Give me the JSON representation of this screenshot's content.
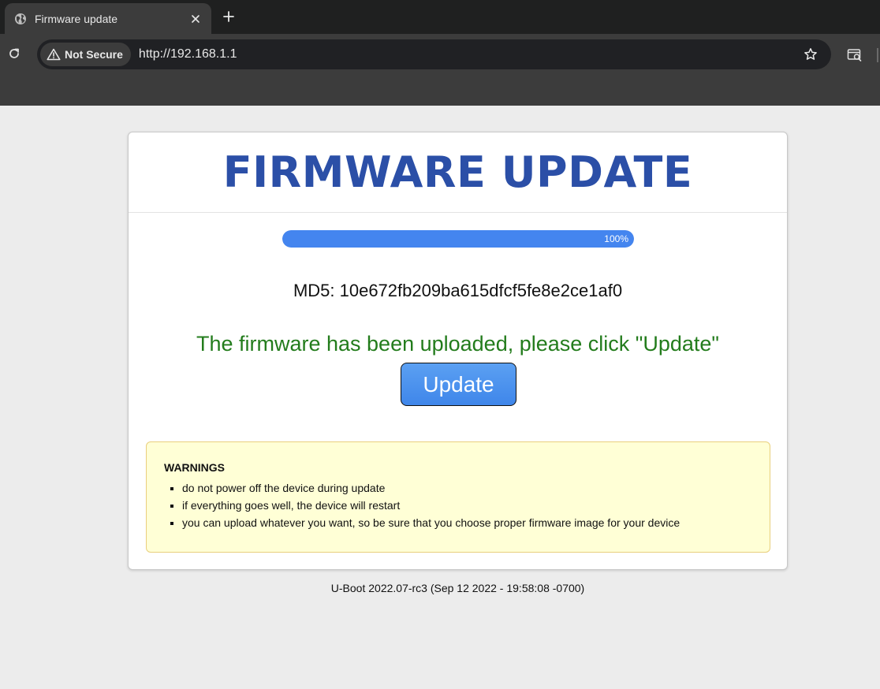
{
  "browser": {
    "tab": {
      "title": "Firmware update",
      "favicon": "globe-icon"
    },
    "new_tab_icon": "plus-icon",
    "close_icon": "close-icon",
    "reload_icon": "reload-icon",
    "security_label": "Not Secure",
    "security_icon": "warning-triangle-icon",
    "url": "http://192.168.1.1",
    "bookmark_icon": "star-icon",
    "tab_search_icon": "tab-search-icon"
  },
  "page": {
    "title": "FIRMWARE UPDATE",
    "progress": {
      "percent": 100,
      "label": "100%"
    },
    "md5": "MD5: 10e672fb209ba615dfcf5fe8e2ce1af0",
    "status_message": "The firmware has been uploaded, please click \"Update\"",
    "update_button": "Update",
    "warnings": {
      "title": "WARNINGS",
      "items": [
        "do not power off the device during update",
        "if everything goes well, the device will restart",
        "you can upload whatever you want, so be sure that you choose proper firmware image for your device"
      ]
    },
    "footer": "U-Boot 2022.07-rc3 (Sep 12 2022 - 19:58:08 -0700)"
  },
  "colors": {
    "title": "#2b4fa7",
    "progress_fill": "#4485ef",
    "status_message": "#237c1c",
    "warning_background": "#ffffd6",
    "warning_border": "#e9cf7d"
  }
}
